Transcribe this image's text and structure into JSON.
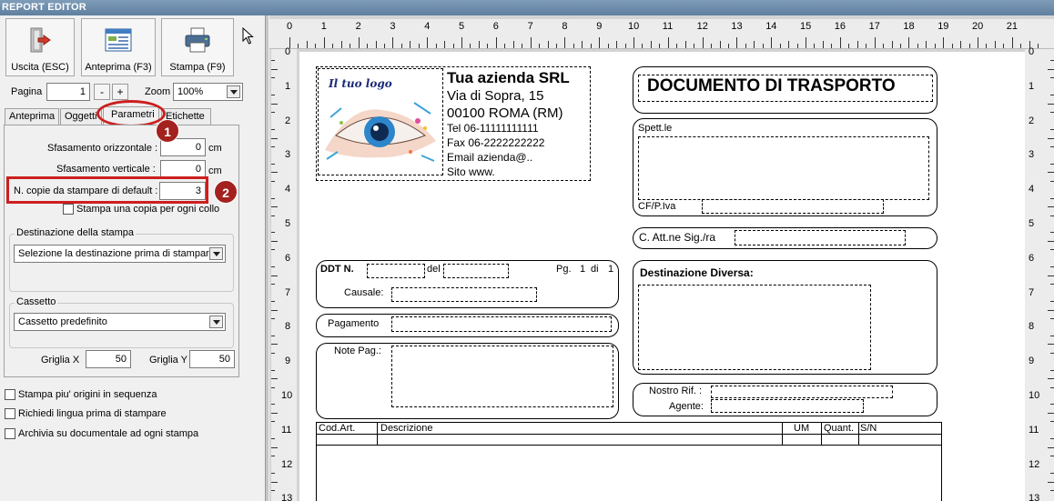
{
  "window": {
    "title": "REPORT EDITOR"
  },
  "toolbar": {
    "exit_label": "Uscita (ESC)",
    "preview_label": "Anteprima (F3)",
    "print_label": "Stampa (F9)"
  },
  "pager": {
    "page_label": "Pagina",
    "page_value": "1",
    "minus": "-",
    "plus": "+",
    "zoom_label": "Zoom",
    "zoom_value": "100%"
  },
  "tabs": [
    "Anteprima",
    "Oggetti",
    "Parametri",
    "Etichette"
  ],
  "params": {
    "h_offset_label": "Sfasamento orizzontale :",
    "h_offset_value": "0",
    "h_unit": "cm",
    "v_offset_label": "Sfasamento verticale :",
    "v_offset_value": "0",
    "v_unit": "cm",
    "copies_label": "N. copie da stampare di default :",
    "copies_value": "3",
    "one_copy_label": "Stampa una copia per ogni collo",
    "dest_group": "Destinazione della stampa",
    "dest_value": "Selezione la destinazione prima di stampare",
    "tray_group": "Cassetto",
    "tray_value": "Cassetto predefinito",
    "grid_x_label": "Griglia X",
    "grid_x_value": "50",
    "grid_y_label": "Griglia Y",
    "grid_y_value": "50"
  },
  "options": [
    "Stampa piu' origini in sequenza",
    "Richiedi lingua prima di stampare",
    "Archivia su documentale ad ogni stampa"
  ],
  "badges": [
    "1",
    "2"
  ],
  "ruler": {
    "h_ticks": [
      "0",
      "1",
      "2",
      "3",
      "4",
      "5",
      "6",
      "7",
      "8",
      "9",
      "10",
      "11",
      "12",
      "13",
      "14",
      "15",
      "16",
      "17",
      "18",
      "19",
      "20",
      "21"
    ],
    "v_ticks": [
      "0",
      "1",
      "2",
      "3",
      "4",
      "5",
      "6",
      "7",
      "8",
      "9",
      "10",
      "11",
      "12",
      "13"
    ]
  },
  "document": {
    "logo_text": "Il tuo logo",
    "company_name": "Tua azienda SRL",
    "address": "Via di Sopra, 15",
    "city": "00100 ROMA (RM)",
    "tel": "Tel 06-11111111111",
    "fax": "Fax 06-2222222222",
    "email": "Email azienda@..",
    "site": "Sito www.",
    "doc_title": "DOCUMENTO DI TRASPORTO",
    "spett": "Spett.le",
    "cf": "CF/P.Iva",
    "attn": "C. Att.ne Sig./ra",
    "ddt": "DDT N.",
    "del": "del",
    "pg": "Pg.",
    "pg_num": "1",
    "di": "di",
    "pg_tot": "1",
    "causale": "Causale:",
    "dest_div": "Destinazione Diversa:",
    "pagamento": "Pagamento",
    "note_pag": "Note Pag.:",
    "nostro_rif": "Nostro Rif. :",
    "agente": "Agente:",
    "col_cod": "Cod.Art.",
    "col_desc": "Descrizione",
    "col_um": "UM",
    "col_quant": "Quant.",
    "col_sn": "S/N"
  }
}
